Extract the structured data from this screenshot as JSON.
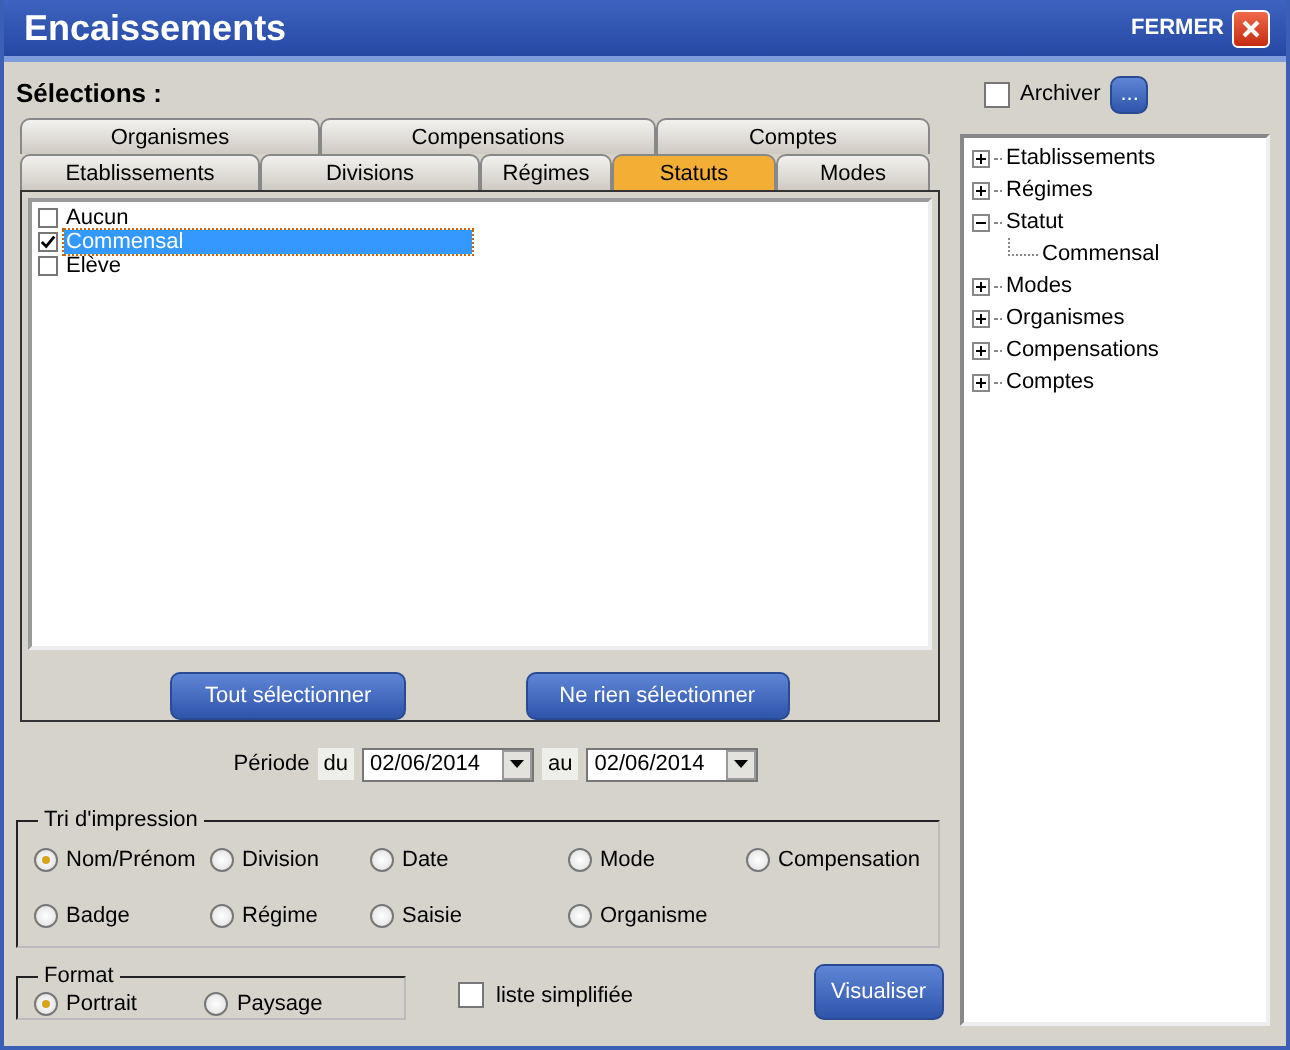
{
  "window": {
    "title": "Encaissements",
    "close_label": "FERMER"
  },
  "selections_label": "Sélections :",
  "tab_rows": [
    {
      "tabs": [
        {
          "label": "Organismes",
          "selected": false
        },
        {
          "label": "Compensations",
          "selected": false
        },
        {
          "label": "Comptes",
          "selected": false
        }
      ]
    },
    {
      "tabs": [
        {
          "label": "Etablissements",
          "selected": false
        },
        {
          "label": "Divisions",
          "selected": false
        },
        {
          "label": "Régimes",
          "selected": false
        },
        {
          "label": "Statuts",
          "selected": true
        },
        {
          "label": "Modes",
          "selected": false
        }
      ]
    }
  ],
  "status_list": [
    {
      "label": "Aucun",
      "checked": false,
      "selected": false
    },
    {
      "label": "Commensal",
      "checked": true,
      "selected": true
    },
    {
      "label": "Elève",
      "checked": false,
      "selected": false
    }
  ],
  "list_buttons": [
    "Tout sélectionner",
    "Ne rien sélectionner"
  ],
  "period": {
    "label": "Période",
    "from_label": "du",
    "from": "02/06/2014",
    "to_label": "au",
    "to": "02/06/2014"
  },
  "sort": {
    "title": "Tri d'impression",
    "options": [
      {
        "label": "Nom/Prénom",
        "selected": true
      },
      {
        "label": "Division",
        "selected": false
      },
      {
        "label": "Date",
        "selected": false
      },
      {
        "label": "Mode",
        "selected": false
      },
      {
        "label": "Compensation",
        "selected": false
      },
      {
        "label": "Badge",
        "selected": false
      },
      {
        "label": "Régime",
        "selected": false
      },
      {
        "label": "Saisie",
        "selected": false
      },
      {
        "label": "Organisme",
        "selected": false
      }
    ]
  },
  "format": {
    "title": "Format",
    "options": [
      {
        "label": "Portrait",
        "selected": true
      },
      {
        "label": "Paysage",
        "selected": false
      }
    ]
  },
  "simplified_list": {
    "label": "liste simplifiée",
    "checked": false
  },
  "view_button": "Visualiser",
  "archive": {
    "label": "Archiver",
    "checked": false,
    "button": "..."
  },
  "tree": [
    {
      "label": "Etablissements",
      "expanded": false
    },
    {
      "label": "Régimes",
      "expanded": false
    },
    {
      "label": "Statut",
      "expanded": true,
      "children": [
        {
          "label": "Commensal"
        }
      ]
    },
    {
      "label": "Modes",
      "expanded": false
    },
    {
      "label": "Organismes",
      "expanded": false
    },
    {
      "label": "Compensations",
      "expanded": false
    },
    {
      "label": "Comptes",
      "expanded": false
    }
  ]
}
